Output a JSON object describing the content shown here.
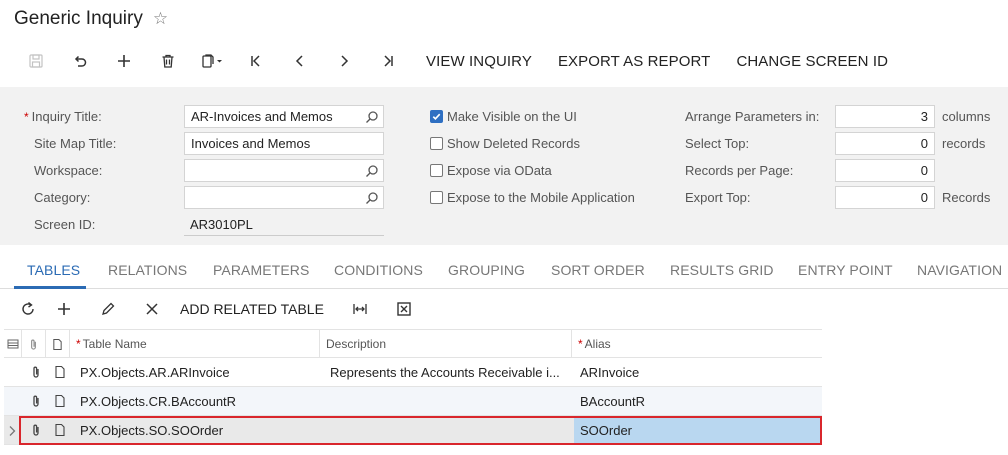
{
  "header": {
    "title": "Generic Inquiry"
  },
  "toolbar": {
    "view_inquiry": "VIEW INQUIRY",
    "export_as_report": "EXPORT AS REPORT",
    "change_screen_id": "CHANGE SCREEN ID"
  },
  "form": {
    "inquiry_title_label": "Inquiry Title:",
    "inquiry_title_value": "AR-Invoices and Memos",
    "site_map_title_label": "Site Map Title:",
    "site_map_title_value": "Invoices and Memos",
    "workspace_label": "Workspace:",
    "workspace_value": "",
    "category_label": "Category:",
    "category_value": "",
    "screen_id_label": "Screen ID:",
    "screen_id_value": "AR3010PL",
    "make_visible_label": "Make Visible on the UI",
    "make_visible_checked": true,
    "show_deleted_label": "Show Deleted Records",
    "show_deleted_checked": false,
    "expose_odata_label": "Expose via OData",
    "expose_odata_checked": false,
    "expose_mobile_label": "Expose to the Mobile Application",
    "expose_mobile_checked": false,
    "arrange_params_label": "Arrange Parameters in:",
    "arrange_params_value": "3",
    "arrange_params_unit": "columns",
    "select_top_label": "Select Top:",
    "select_top_value": "0",
    "select_top_unit": "records",
    "records_per_page_label": "Records per Page:",
    "records_per_page_value": "0",
    "export_top_label": "Export Top:",
    "export_top_value": "0",
    "export_top_unit": "Records"
  },
  "tabs": [
    "TABLES",
    "RELATIONS",
    "PARAMETERS",
    "CONDITIONS",
    "GROUPING",
    "SORT ORDER",
    "RESULTS GRID",
    "ENTRY POINT",
    "NAVIGATION"
  ],
  "grid_toolbar": {
    "add_related_table": "ADD RELATED TABLE"
  },
  "grid": {
    "columns": {
      "table_name": "Table Name",
      "description": "Description",
      "alias": "Alias"
    },
    "rows": [
      {
        "table_name": "PX.Objects.AR.ARInvoice",
        "description": "Represents the Accounts Receivable i...",
        "alias": "ARInvoice"
      },
      {
        "table_name": "PX.Objects.CR.BAccountR",
        "description": "",
        "alias": "BAccountR"
      },
      {
        "table_name": "PX.Objects.SO.SOOrder",
        "description": "",
        "alias": "SOOrder"
      }
    ]
  },
  "colors": {
    "accent": "#2b6bb4",
    "highlight": "#d9262c",
    "selected_cell": "#b9d7f0"
  }
}
